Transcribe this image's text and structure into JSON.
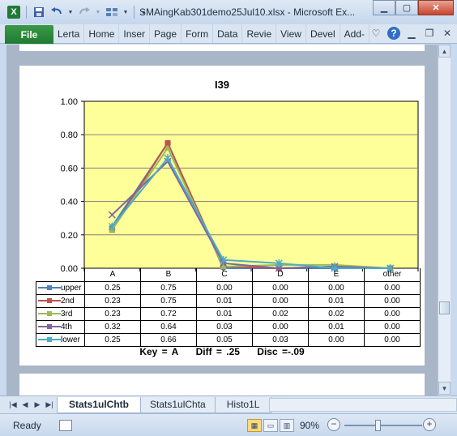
{
  "window": {
    "title": "SMAingKab301demo25Jul10.xlsx - Microsoft Ex..."
  },
  "ribbon": {
    "file": "File",
    "tabs": [
      "Lerta",
      "Home",
      "Inser",
      "Page",
      "Form",
      "Data",
      "Revie",
      "View",
      "Devel",
      "Add-"
    ]
  },
  "sheet_tabs": [
    "Stats1ulChtb",
    "Stats1ulChta",
    "Histo1L"
  ],
  "status": {
    "ready": "Ready",
    "zoom": "90%",
    "zoom_level_percent": 90
  },
  "chart_data": {
    "type": "line",
    "title": "I39",
    "categories": [
      "A",
      "B",
      "C",
      "D",
      "E",
      "other"
    ],
    "ylim": [
      0,
      1
    ],
    "yticks": [
      "0.00",
      "0.20",
      "0.40",
      "0.60",
      "0.80",
      "1.00"
    ],
    "grid": true,
    "plot_background": "#ffff99",
    "series": [
      {
        "name": "upper",
        "color": "#4f81bd",
        "marker": "diamond",
        "values": [
          0.25,
          0.75,
          0.0,
          0.0,
          0.0,
          0.0
        ],
        "labels": [
          "0.25",
          "0.75",
          "0.00",
          "0.00",
          "0.00",
          "0.00"
        ]
      },
      {
        "name": "2nd",
        "color": "#c0504d",
        "marker": "square",
        "values": [
          0.23,
          0.75,
          0.01,
          0.0,
          0.01,
          0.0
        ],
        "labels": [
          "0.23",
          "0.75",
          "0.01",
          "0.00",
          "0.01",
          "0.00"
        ]
      },
      {
        "name": "3rd",
        "color": "#9bbb59",
        "marker": "triangle",
        "values": [
          0.23,
          0.72,
          0.01,
          0.02,
          0.02,
          0.0
        ],
        "labels": [
          "0.23",
          "0.72",
          "0.01",
          "0.02",
          "0.02",
          "0.00"
        ]
      },
      {
        "name": "4th",
        "color": "#8064a2",
        "marker": "x",
        "values": [
          0.32,
          0.64,
          0.03,
          0.0,
          0.01,
          0.0
        ],
        "labels": [
          "0.32",
          "0.64",
          "0.03",
          "0.00",
          "0.01",
          "0.00"
        ]
      },
      {
        "name": "lower",
        "color": "#4bacc6",
        "marker": "star",
        "values": [
          0.25,
          0.66,
          0.05,
          0.03,
          0.0,
          0.0
        ],
        "labels": [
          "0.25",
          "0.66",
          "0.05",
          "0.03",
          "0.00",
          "0.00"
        ]
      }
    ],
    "footer": {
      "key": "Key = A",
      "diff": "Diff = .25",
      "disc": "Disc =-.09"
    }
  }
}
